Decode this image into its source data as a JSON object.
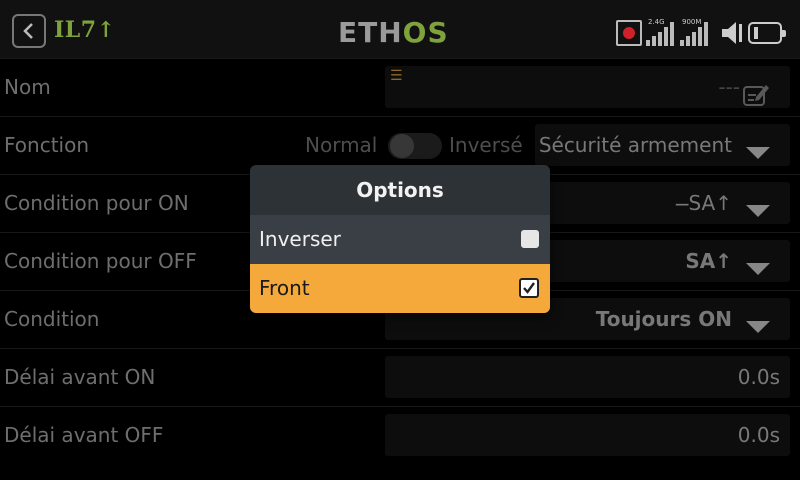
{
  "header": {
    "model_name": "IL7↑",
    "logo_left": "ETH",
    "logo_right": "OS",
    "signal_24_label": "2.4G",
    "signal_900_label": "900M"
  },
  "rows": [
    {
      "label": "Nom",
      "value": "---"
    },
    {
      "label": "Fonction",
      "switch_left": "Normal",
      "switch_right": "Inversé",
      "value": "Sécurité armement"
    },
    {
      "label": "Condition pour ON",
      "value": "̶SA↑"
    },
    {
      "label": "Condition pour OFF",
      "value": "SA↑"
    },
    {
      "label": "Condition",
      "value": "Toujours ON"
    },
    {
      "label": "Délai avant ON",
      "value": "0.0s"
    },
    {
      "label": "Délai avant OFF",
      "value": "0.0s"
    }
  ],
  "dialog": {
    "title": "Options",
    "options": [
      {
        "label": "Inverser",
        "checked": false
      },
      {
        "label": "Front",
        "checked": true
      }
    ]
  },
  "colors": {
    "accent_green": "#7fa23d",
    "highlight_orange": "#f5a93a",
    "dialog_bg": "#2d3237"
  }
}
